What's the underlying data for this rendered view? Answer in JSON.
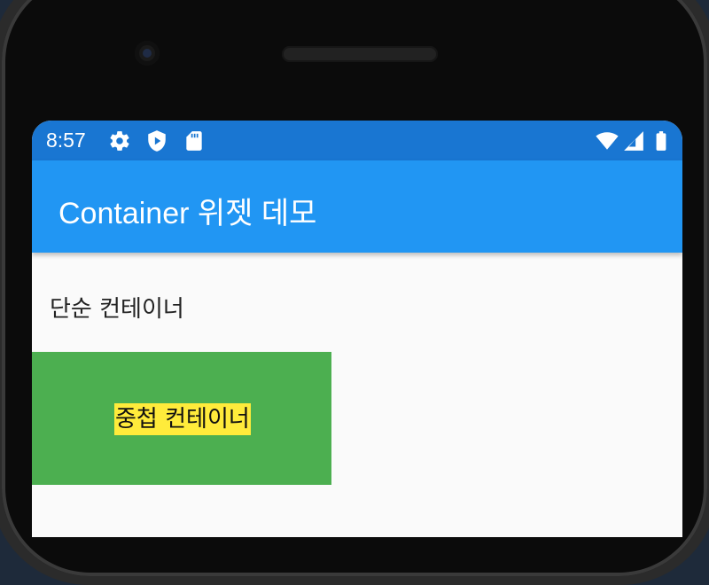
{
  "status_bar": {
    "time": "8:57",
    "icons_left": [
      "gear-icon",
      "shield-play-icon",
      "sd-card-icon"
    ],
    "icons_right": [
      "wifi-icon",
      "signal-icon",
      "battery-icon"
    ],
    "color": "#1976d2"
  },
  "app_bar": {
    "title": "Container 위젯 데모",
    "color": "#2196f3"
  },
  "body": {
    "simple_container_text": "단순 컨테이너",
    "nested_container_text": "중첩 컨테이너",
    "outer_container_color": "#4caf50",
    "inner_container_color": "#ffeb3b"
  }
}
